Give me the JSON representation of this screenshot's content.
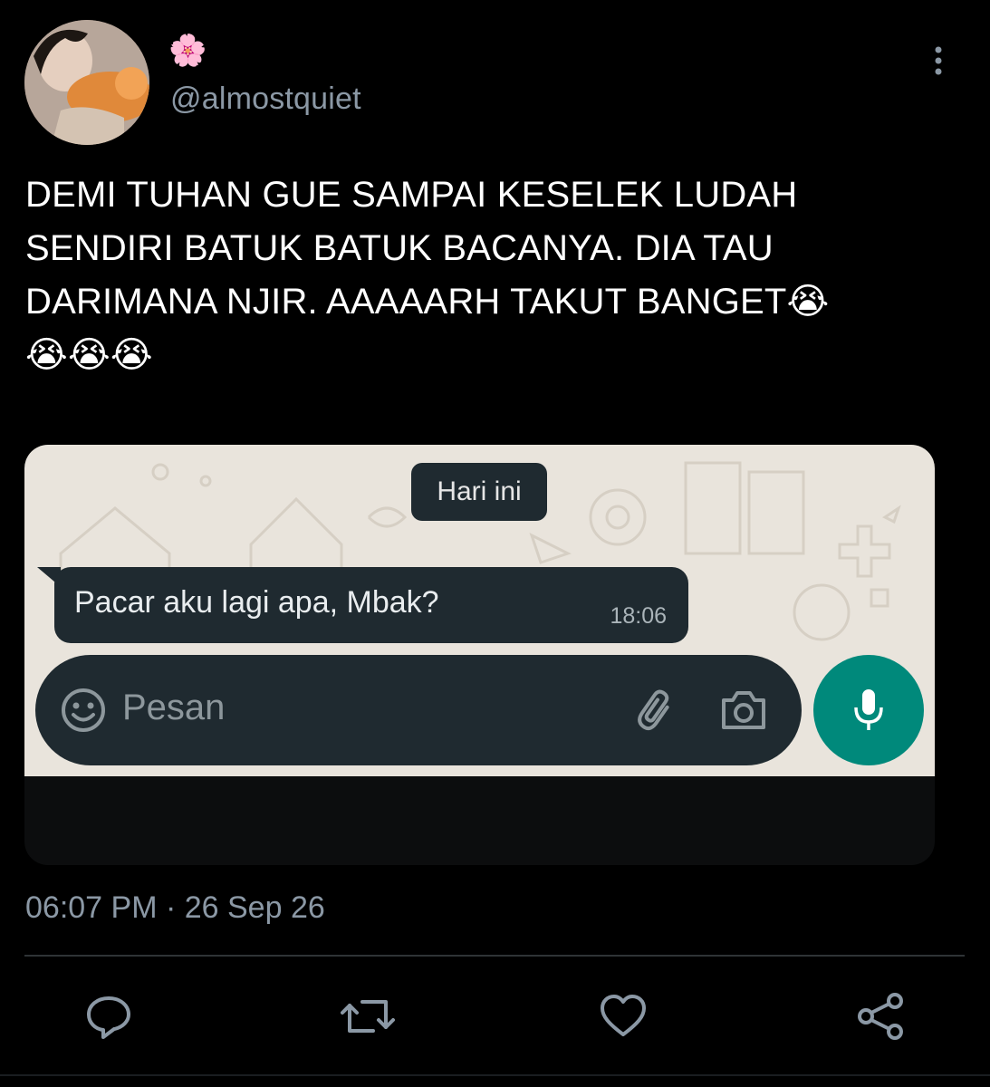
{
  "author": {
    "display_name": "🌸",
    "handle": "@almostquiet"
  },
  "tweet": {
    "lines": [
      "DEMI TUHAN GUE SAMPAI KESELEK LUDAH",
      "SENDIRI BATUK BATUK BACANYA. DIA TAU",
      "DARIMANA NJIR. AAAAARH TAKUT BANGET😭",
      "😭😭😭"
    ],
    "timestamp": "06:07 PM · 26 Sep 26"
  },
  "media": {
    "date_chip": "Hari ini",
    "message": {
      "text": "Pacar aku lagi apa, Mbak?",
      "time": "18:06"
    },
    "composer": {
      "placeholder": "Pesan"
    },
    "colors": {
      "chat_bg": "#e9e4dc",
      "bubble": "#1f2a30",
      "mic": "#00897b"
    }
  },
  "icons": {
    "more": "more-vertical-icon",
    "reply": "reply-icon",
    "retweet": "retweet-icon",
    "like": "heart-icon",
    "share": "share-icon",
    "emoji": "emoji-icon",
    "attach": "paperclip-icon",
    "camera": "camera-icon",
    "mic": "mic-icon"
  }
}
